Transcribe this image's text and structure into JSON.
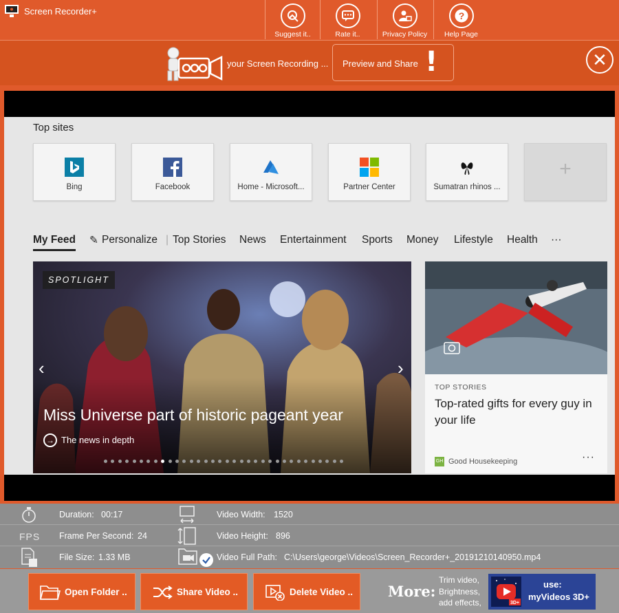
{
  "app": {
    "title": "Screen Recorder+"
  },
  "top_buttons": [
    {
      "label": "Suggest it..",
      "icon": "suggest-icon"
    },
    {
      "label": "Rate it..",
      "icon": "chat-icon"
    },
    {
      "label": "Privacy Policy",
      "icon": "privacy-user-icon"
    },
    {
      "label": "Help Page",
      "icon": "help-icon"
    }
  ],
  "recorder": {
    "status_text": "your Screen Recording ...",
    "preview_button": "Preview and Share",
    "alert_glyph": "!",
    "close_glyph": "✕"
  },
  "browser": {
    "top_sites_label": "Top sites",
    "top_sites": [
      {
        "name": "Bing",
        "icon": "bing-icon"
      },
      {
        "name": "Facebook",
        "icon": "facebook-icon"
      },
      {
        "name": "Home - Microsoft...",
        "icon": "azure-icon"
      },
      {
        "name": "Partner Center",
        "icon": "microsoft-icon"
      },
      {
        "name": "Sumatran rhinos ...",
        "icon": "butterfly-icon"
      }
    ],
    "add_site_glyph": "+",
    "nav": {
      "my_feed": "My Feed",
      "personalize": "Personalize",
      "separator": "|",
      "tabs": [
        "Top Stories",
        "News",
        "Entertainment",
        "Sports",
        "Money",
        "Lifestyle",
        "Health"
      ],
      "more": "···"
    },
    "hero": {
      "badge": "SPOTLIGHT",
      "title": "Miss Universe part of historic pageant year",
      "link": "The news in depth",
      "prev": "‹",
      "next": "›",
      "slide_count": 34,
      "active_slide": 8
    },
    "card": {
      "kicker": "TOP STORIES",
      "title": "Top-rated gifts for every guy in your life",
      "source_badge": "GH",
      "source": "Good Housekeeping",
      "more": "···"
    }
  },
  "info": {
    "duration_label": "Duration:",
    "duration": "00:17",
    "fps_icon_text": "FPS",
    "fps_label": "Frame Per Second:",
    "fps": "24",
    "size_label": "File Size:",
    "size": "1.33 MB",
    "width_label": "Video Width:",
    "width": "1520",
    "height_label": "Video Height:",
    "height": "896",
    "path_label": "Video Full Path:",
    "path": "C:\\Users\\george\\Videos\\Screen_Recorder+_20191210140950.mp4"
  },
  "actions": {
    "open_folder": "Open Folder ..",
    "share_video": "Share Video ..",
    "delete_video": "Delete Video ..",
    "more": "More:",
    "more_lines": [
      "Trim video,",
      "Brightness,",
      "add effects,"
    ],
    "promo_line1": "use:",
    "promo_line2": "myVideos 3D+",
    "promo_badge": "3D+"
  },
  "colors": {
    "accent": "#e05a2b",
    "panel": "#8e8e8e",
    "promo": "#2b4496"
  }
}
